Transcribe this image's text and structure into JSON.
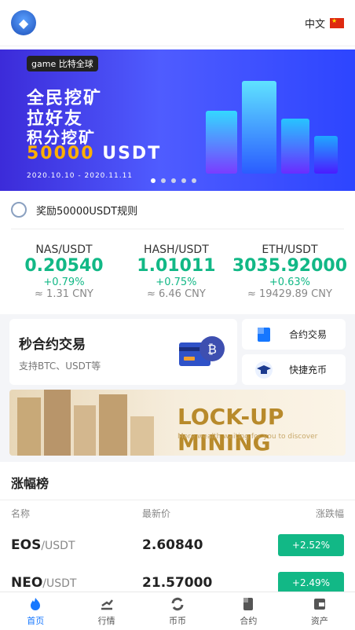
{
  "header": {
    "language": "中文"
  },
  "banner": {
    "badge": "game 比特全球",
    "line1": "全民挖矿",
    "line2": "拉好友",
    "line3": "积分挖矿",
    "amount": "50000",
    "unit": "USDT",
    "date": "2020.10.10 - 2020.11.11",
    "slides": 5,
    "active_slide": 1
  },
  "notice": {
    "text": "奖励50000USDT规则"
  },
  "tickers": [
    {
      "pair": "NAS/USDT",
      "price": "0.20540",
      "change": "+0.79%",
      "cny": "≈ 1.31 CNY"
    },
    {
      "pair": "HASH/USDT",
      "price": "1.01011",
      "change": "+0.75%",
      "cny": "≈ 6.46 CNY"
    },
    {
      "pair": "ETH/USDT",
      "price": "3035.92000",
      "change": "+0.63%",
      "cny": "≈ 19429.89 CNY"
    }
  ],
  "contract_card": {
    "title": "秒合约交易",
    "subtitle": "支持BTC、USDT等"
  },
  "quick_links": [
    {
      "label": "合约交易",
      "icon": "document-icon"
    },
    {
      "label": "快捷充币",
      "icon": "graduation-cap-icon"
    }
  ],
  "mining_banner": {
    "title": "LOCK-UP MINING",
    "subtitle": "More wealth waiting for you to discover"
  },
  "ranking": {
    "title": "涨幅榜",
    "headers": [
      "名称",
      "最新价",
      "涨跌幅"
    ],
    "rows": [
      {
        "base": "EOS",
        "quote": "/USDT",
        "price": "2.60840",
        "change": "+2.52%"
      },
      {
        "base": "NEO",
        "quote": "/USDT",
        "price": "21.57000",
        "change": "+2.49%"
      }
    ]
  },
  "tabbar": [
    {
      "label": "首页",
      "icon": "home-flame-icon",
      "active": true
    },
    {
      "label": "行情",
      "icon": "market-icon",
      "active": false
    },
    {
      "label": "币币",
      "icon": "exchange-icon",
      "active": false
    },
    {
      "label": "合约",
      "icon": "contract-icon",
      "active": false
    },
    {
      "label": "资产",
      "icon": "wallet-icon",
      "active": false
    }
  ],
  "colors": {
    "accent_green": "#12b886",
    "active_blue": "#1677ff",
    "banner_blue": "#3c2bd9"
  }
}
